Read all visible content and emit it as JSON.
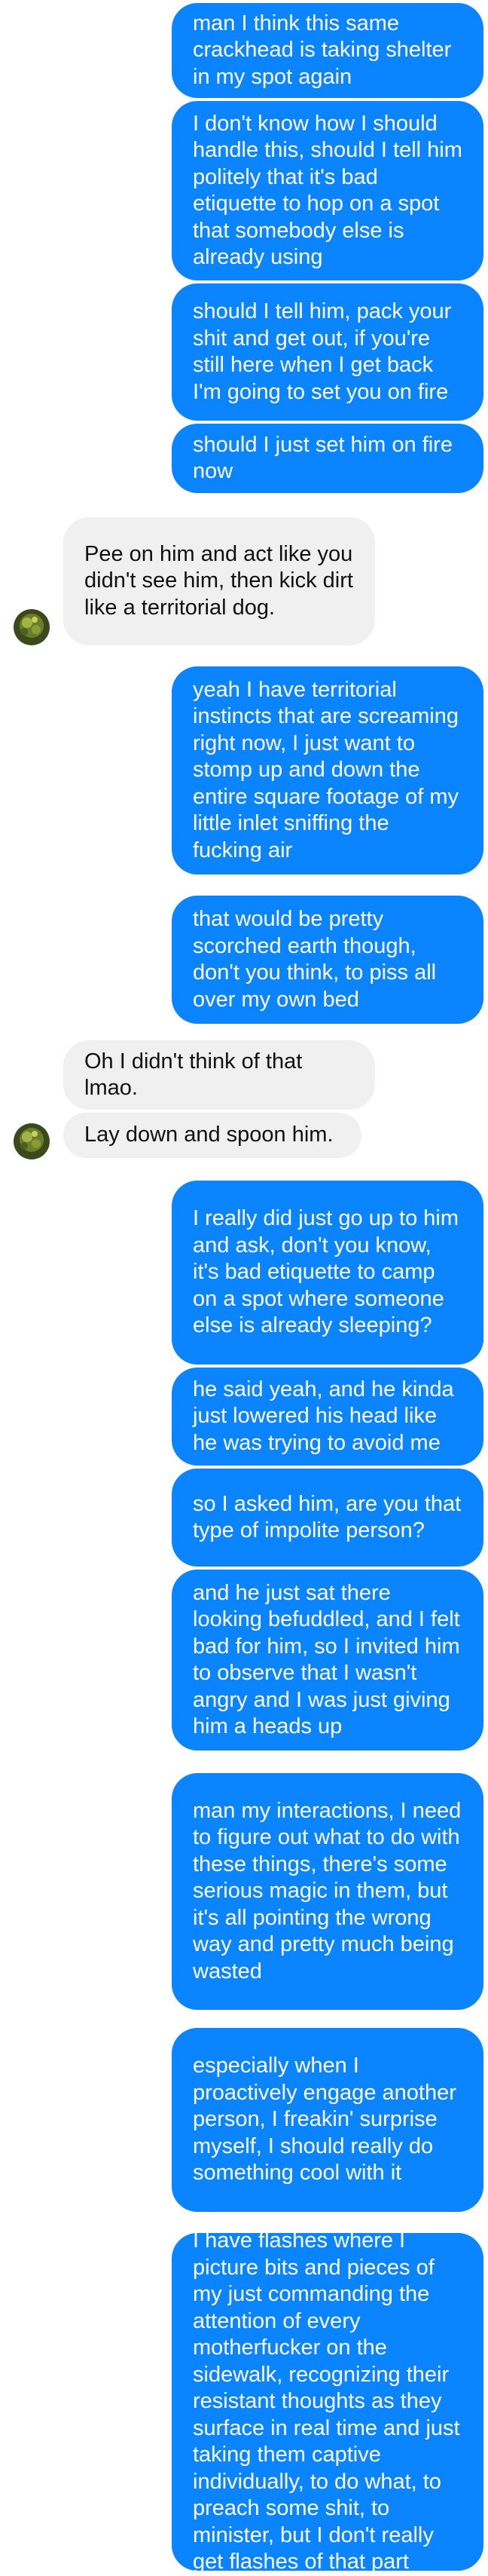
{
  "colors": {
    "outgoing": "#0a84ff",
    "incoming": "#f1f0f0",
    "outgoing_text": "#ffffff",
    "incoming_text": "#111111"
  },
  "messages": [
    {
      "from": "me",
      "text": "man I think this same crackhead is taking shelter in my spot again"
    },
    {
      "from": "me",
      "text": "I don't know how I should handle this, should I tell him politely that it's bad etiquette to hop on a spot that somebody else is already using"
    },
    {
      "from": "me",
      "text": "should I tell him, pack your shit and get out, if you're still here when I get back I'm going to set you on fire"
    },
    {
      "from": "me",
      "text": "should I just set him on fire now"
    },
    {
      "from": "them",
      "text": "Pee on him and act like you didn't see him, then kick dirt like a territorial dog."
    },
    {
      "from": "me",
      "text": "yeah I have territorial instincts that are screaming right now, I just want to stomp up and down the entire square footage of my little inlet sniffing the fucking air"
    },
    {
      "from": "me",
      "text": "that would be pretty scorched earth though, don't you think, to piss all over my own bed"
    },
    {
      "from": "them",
      "text": "Oh I didn't think of that lmao."
    },
    {
      "from": "them",
      "text": "Lay down and spoon him."
    },
    {
      "from": "me",
      "text": "I really did just go up to him and ask, don't you know, it's bad etiquette to camp on a spot where someone else is already sleeping?"
    },
    {
      "from": "me",
      "text": "he said yeah, and he kinda just lowered his head like he was trying to avoid me"
    },
    {
      "from": "me",
      "text": "so I asked him, are you that type of impolite person?"
    },
    {
      "from": "me",
      "text": "and he just sat there looking befuddled, and I felt bad for him, so I invited him to observe that I wasn't angry and I was just giving him a heads up"
    },
    {
      "from": "me",
      "text": "man my interactions, I need to figure out what to do with these things, there's some serious magic in them, but it's all pointing the wrong way and pretty much being wasted"
    },
    {
      "from": "me",
      "text": "especially when I proactively engage another person, I freakin' surprise myself, I should really do something cool with it"
    },
    {
      "from": "me",
      "text": "I have flashes where I picture bits and pieces of my just commanding the attention of every motherfucker on the sidewalk, recognizing their resistant thoughts as they surface in real time and just taking them captive individually, to do what, to preach some shit, to minister, but I don't really get flashes of that part"
    }
  ],
  "avatar": {
    "icon": "contact-avatar-photo"
  }
}
